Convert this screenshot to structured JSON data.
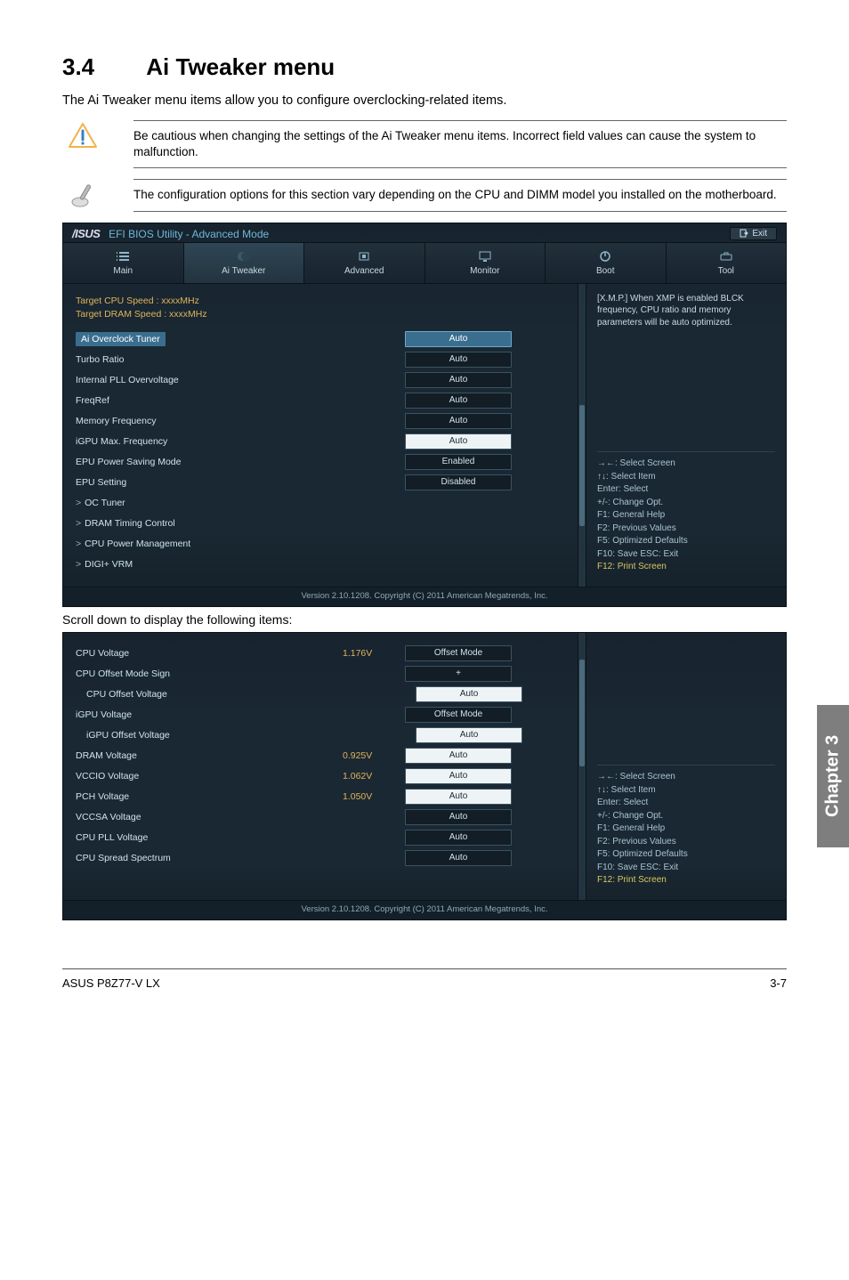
{
  "section": {
    "number": "3.4",
    "title": "Ai Tweaker menu"
  },
  "intro": "The Ai Tweaker menu items allow you to configure overclocking-related items.",
  "warning": "Be cautious when changing the settings of the Ai Tweaker menu items. Incorrect field values can cause the system to malfunction.",
  "note": "The configuration options for this section vary depending on the CPU and DIMM model you installed on the motherboard.",
  "bios": {
    "brand": "/ISUS",
    "title": "EFI BIOS Utility - Advanced Mode",
    "exit": "Exit",
    "tabs": [
      "Main",
      "Ai Tweaker",
      "Advanced",
      "Monitor",
      "Boot",
      "Tool"
    ],
    "targets": {
      "cpu": "Target CPU Speed : xxxxMHz",
      "dram": "Target DRAM Speed : xxxxMHz"
    },
    "settings1": [
      {
        "label": "Ai Overclock Tuner",
        "value": "Auto",
        "style": "sel",
        "selected": true
      },
      {
        "label": "Turbo Ratio",
        "value": "Auto",
        "style": "dark"
      },
      {
        "label": "Internal PLL Overvoltage",
        "value": "Auto",
        "style": "dark"
      },
      {
        "label": "FreqRef",
        "value": "Auto",
        "style": "dark"
      },
      {
        "label": "Memory Frequency",
        "value": "Auto",
        "style": "dark"
      },
      {
        "label": "iGPU Max. Frequency",
        "value": "Auto",
        "style": "light"
      },
      {
        "label": "EPU Power Saving Mode",
        "value": "Enabled",
        "style": "dark"
      },
      {
        "label": "EPU Setting",
        "value": "Disabled",
        "style": "dark"
      },
      {
        "label": "OC Tuner",
        "chev": true
      },
      {
        "label": "DRAM Timing Control",
        "chev": true
      },
      {
        "label": "CPU Power Management",
        "chev": true
      },
      {
        "label": "DIGI+ VRM",
        "chev": true
      }
    ],
    "help1": "[X.M.P.] When XMP is enabled BLCK frequency, CPU ratio and memory parameters will be auto optimized.",
    "keys": [
      "→←: Select Screen",
      "↑↓: Select Item",
      "Enter: Select",
      "+/-: Change Opt.",
      "F1: General Help",
      "F2: Previous Values",
      "F5: Optimized Defaults",
      "F10: Save   ESC: Exit",
      "F12: Print Screen"
    ],
    "footer": "Version 2.10.1208.   Copyright (C) 2011 American Megatrends, Inc."
  },
  "scroll_note": "Scroll down to display the following items:",
  "settings2": [
    {
      "label": "CPU Voltage",
      "read": "1.176V",
      "value": "Offset Mode",
      "style": "dark"
    },
    {
      "label": "CPU Offset Mode Sign",
      "value": "+",
      "style": "dark"
    },
    {
      "label": "CPU Offset Voltage",
      "sub": true,
      "value": "Auto",
      "style": "light"
    },
    {
      "label": "iGPU Voltage",
      "value": "Offset Mode",
      "style": "dark"
    },
    {
      "label": "iGPU Offset Voltage",
      "sub": true,
      "value": "Auto",
      "style": "light"
    },
    {
      "label": "DRAM Voltage",
      "read": "0.925V",
      "value": "Auto",
      "style": "light"
    },
    {
      "label": "VCCIO Voltage",
      "read": "1.062V",
      "value": "Auto",
      "style": "light"
    },
    {
      "label": "PCH Voltage",
      "read": "1.050V",
      "value": "Auto",
      "style": "light"
    },
    {
      "label": "VCCSA Voltage",
      "value": "Auto",
      "style": "dark"
    },
    {
      "label": "CPU PLL Voltage",
      "value": "Auto",
      "style": "dark"
    },
    {
      "label": "CPU Spread Spectrum",
      "value": "Auto",
      "style": "dark"
    }
  ],
  "chapter_tab": "Chapter 3",
  "footer": {
    "left": "ASUS P8Z77-V LX",
    "right": "3-7"
  }
}
